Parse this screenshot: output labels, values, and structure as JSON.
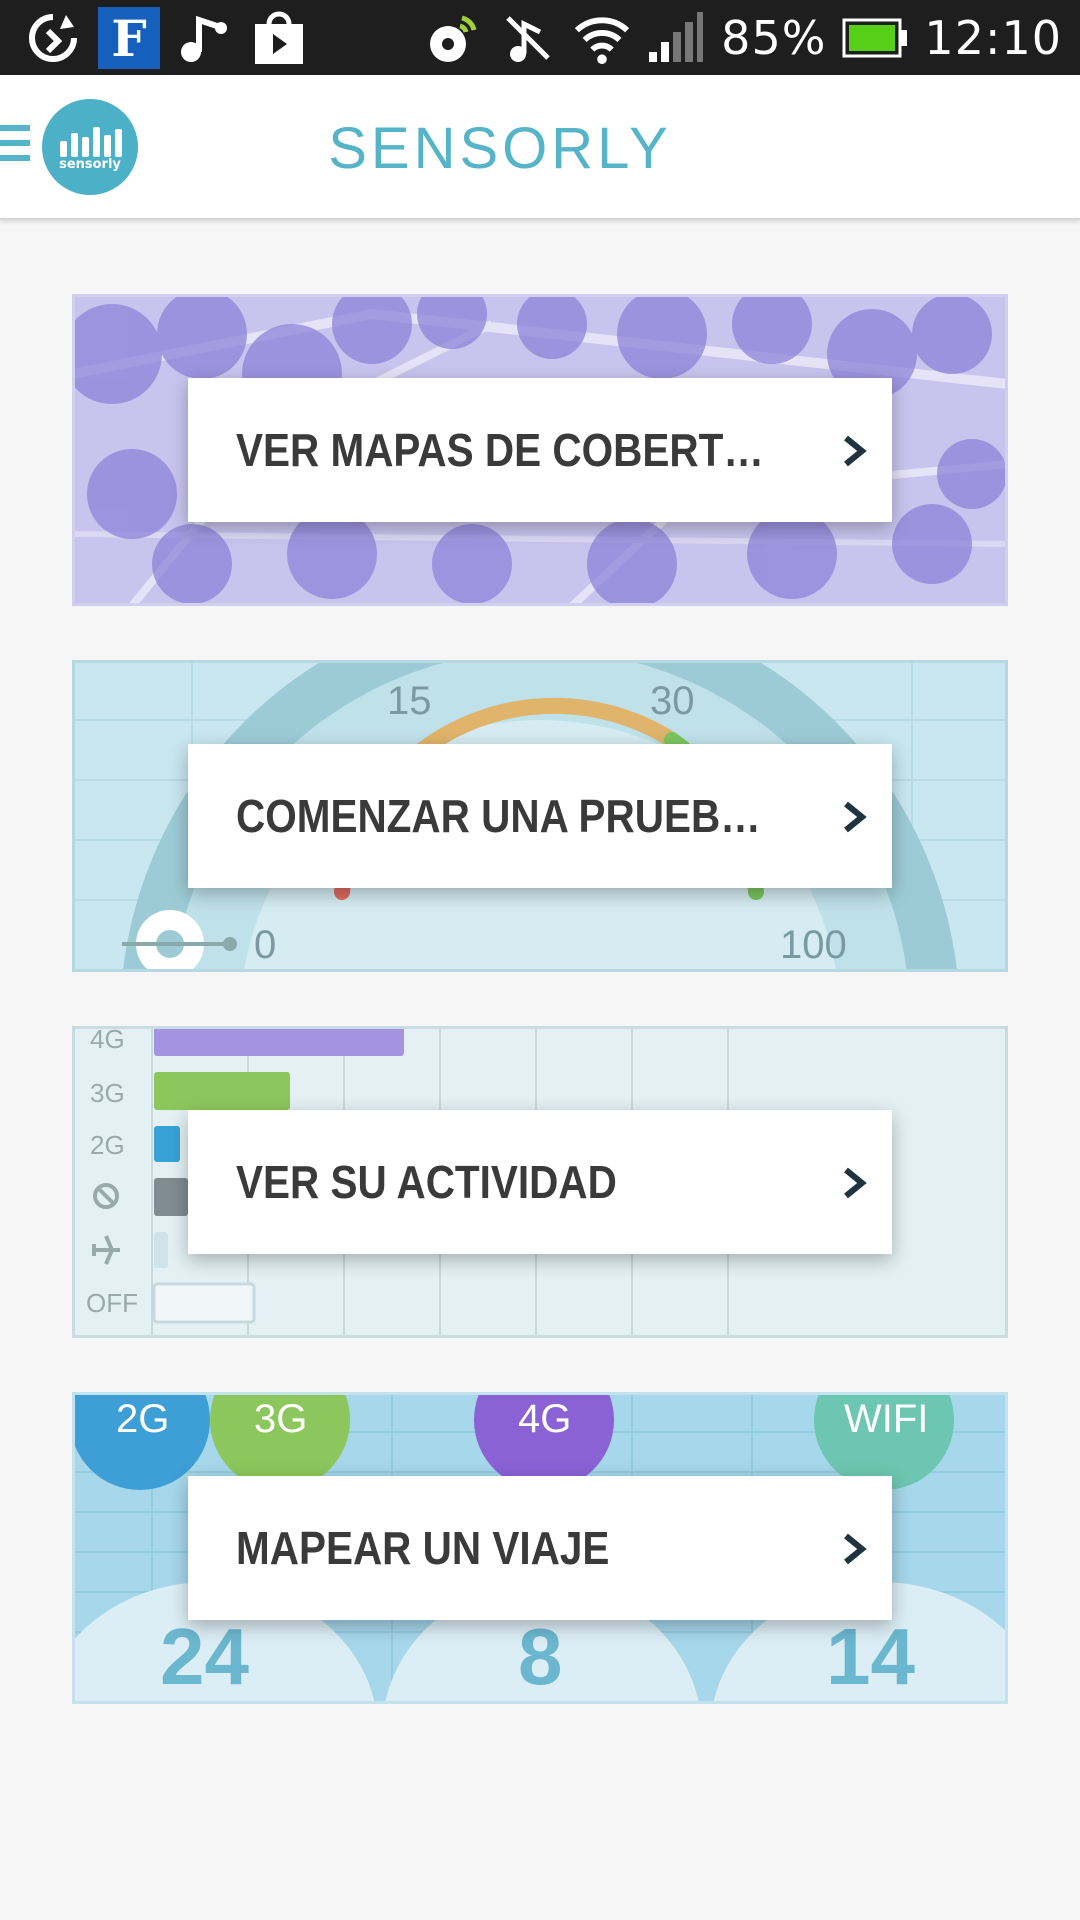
{
  "status_bar": {
    "left_icons": [
      "sync-icon",
      "f-app-icon",
      "music-icon",
      "play-store-icon"
    ],
    "battery_percent": "85%",
    "time": "12:10",
    "right_icons": [
      "signal-tower-icon",
      "mute-icon",
      "wifi-icon",
      "cell-signal-icon",
      "battery-icon"
    ]
  },
  "app_bar": {
    "title": "SENSORLY",
    "logo_text": "sensorly",
    "menu_icon": "hamburger-menu-icon"
  },
  "cards": [
    {
      "label": "VER MAPAS DE COBERTURA",
      "icon": "chevron-right-icon",
      "background": "coverage-map"
    },
    {
      "label": "COMENZAR UNA PRUEBA DE VEL...",
      "icon": "chevron-right-icon",
      "background": "speed-gauge",
      "gauge_labels": [
        "15",
        "30",
        "0",
        "100"
      ]
    },
    {
      "label": "VER SU ACTIVIDAD",
      "icon": "chevron-right-icon",
      "background": "activity-chart",
      "rows": [
        "4G",
        "3G",
        "2G",
        "OFF"
      ]
    },
    {
      "label": "MAPEAR UN VIAJE",
      "icon": "chevron-right-icon",
      "background": "network-bubbles",
      "bubbles": [
        "2G",
        "3G",
        "4G",
        "WIFI"
      ],
      "counts": [
        "24",
        "8",
        "14"
      ]
    }
  ],
  "colors": {
    "accent": "#56b4c9",
    "status_bar_bg": "#1e1e1e",
    "page_bg": "#f6f6f6",
    "label_text": "#3a3a3a",
    "chevron": "#1f3440"
  }
}
